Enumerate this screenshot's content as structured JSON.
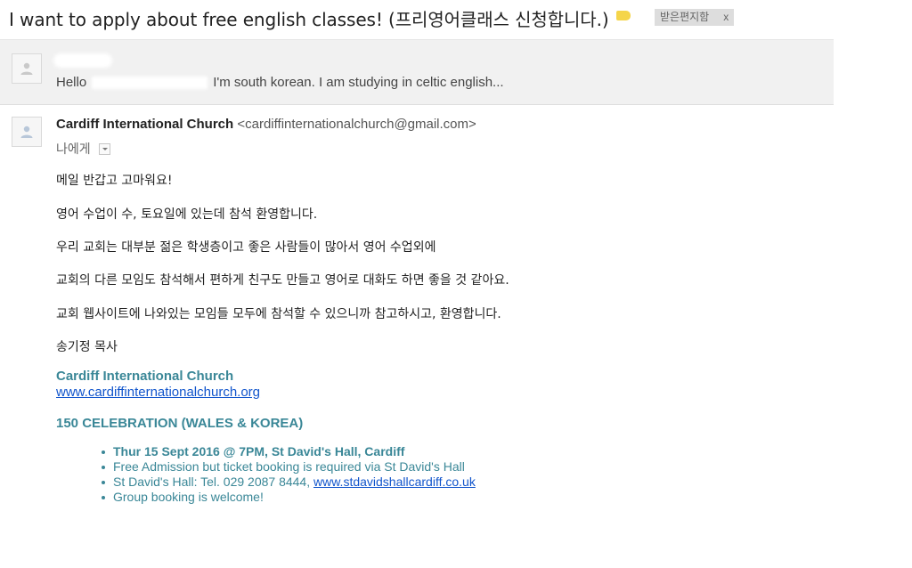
{
  "thread": {
    "subject": "I want to apply about free english classes! (프리영어클래스 신청합니다.)",
    "label_tag": "받은편지함",
    "label_remove": "x"
  },
  "collapsed_message": {
    "snippet_start": "Hello",
    "snippet_end": "I'm south korean. I am studying in celtic english..."
  },
  "message": {
    "sender_name": "Cardiff International Church",
    "sender_email": "<cardiffinternationalchurch@gmail.com>",
    "recipient": "나에게",
    "body": [
      "메일 반갑고 고마워요!",
      "영어 수업이 수, 토요일에 있는데 참석 환영합니다.",
      "우리 교회는 대부분 젊은 학생층이고 좋은 사람들이 많아서 영어 수업외에",
      "교회의 다른 모임도 참석해서 편하게 친구도 만들고 영어로 대화도 하면 좋을 것 같아요.",
      "교회 웹사이트에 나와있는 모임들 모두에 참석할 수 있으니까 참고하시고, 환영합니다.",
      "송기정 목사"
    ],
    "signature_org": "Cardiff International Church",
    "signature_url": "www.cardiffinternationalchurch.org",
    "celebration_title": "150 CELEBRATION (WALES & KOREA)",
    "bullets": {
      "event": "Thur 15 Sept 2016 @ 7PM,  St David's Hall, Cardiff",
      "admission": "Free Admission but ticket booking is required via St David's Hall",
      "tel_prefix": "St David's Hall: Tel. 029 2087 8444, ",
      "tel_link": "www.stdavidshallcardiff.co.uk",
      "group": "Group booking is welcome!"
    }
  },
  "colors": {
    "accent_teal": "#3a8797",
    "link_blue": "#1155cc",
    "label_yellow": "#f5d54a"
  }
}
